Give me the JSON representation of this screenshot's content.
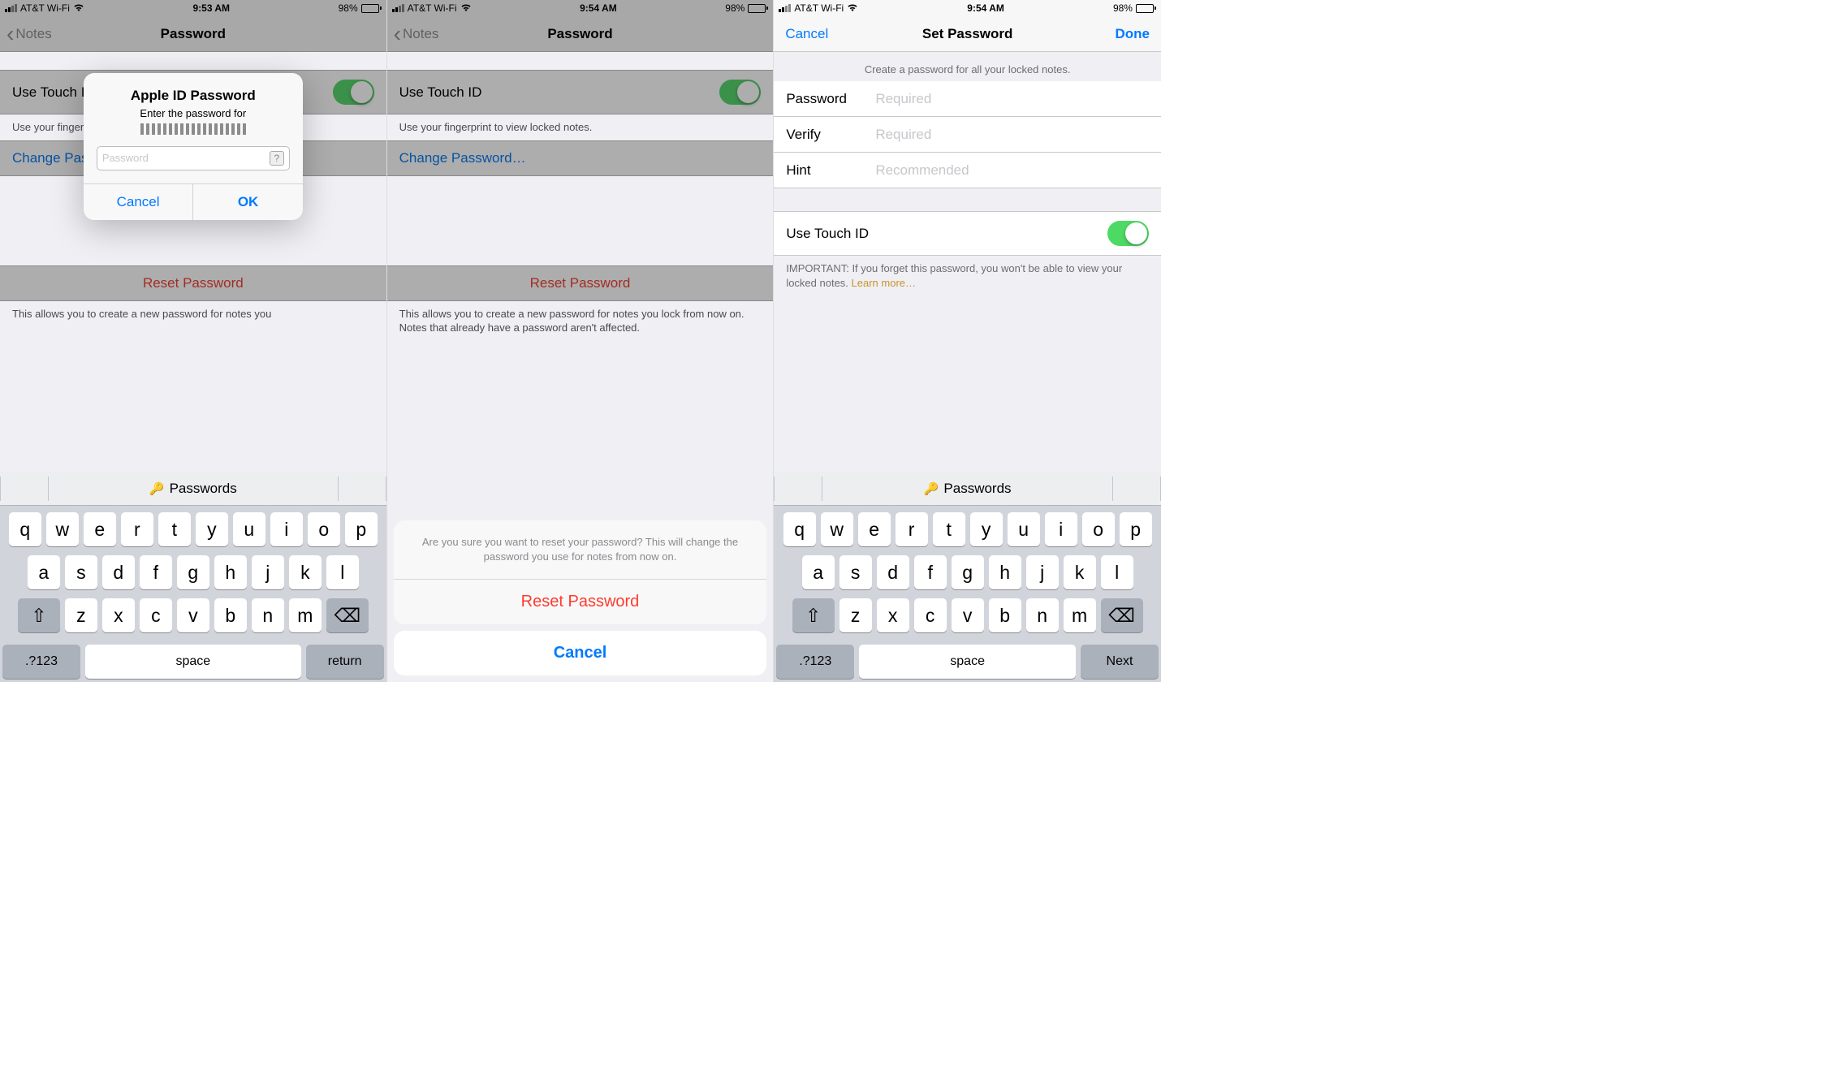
{
  "screens": [
    {
      "status": {
        "carrier": "AT&T Wi-Fi",
        "time": "9:53 AM",
        "battery_pct": "98%"
      },
      "nav": {
        "back": "Notes",
        "title": "Password"
      },
      "settings": {
        "use_touch_id_label": "Use Touch ID",
        "use_touch_id_on": true,
        "touch_id_footer": "Use your fingerprint to view locked notes.",
        "change_password_label": "Change Password…",
        "reset_password_label": "Reset Password",
        "reset_footer": "This allows you to create a new password for notes you"
      },
      "alert": {
        "title": "Apple ID Password",
        "message": "Enter the password for",
        "input_placeholder": "Password",
        "cancel": "Cancel",
        "ok": "OK"
      },
      "keyboard": {
        "suggestion": "Passwords",
        "row1": [
          "q",
          "w",
          "e",
          "r",
          "t",
          "y",
          "u",
          "i",
          "o",
          "p"
        ],
        "row2": [
          "a",
          "s",
          "d",
          "f",
          "g",
          "h",
          "j",
          "k",
          "l"
        ],
        "row3": [
          "z",
          "x",
          "c",
          "v",
          "b",
          "n",
          "m"
        ],
        "numkey": ".?123",
        "space": "space",
        "return": "return"
      }
    },
    {
      "status": {
        "carrier": "AT&T Wi-Fi",
        "time": "9:54 AM",
        "battery_pct": "98%"
      },
      "nav": {
        "back": "Notes",
        "title": "Password"
      },
      "settings": {
        "use_touch_id_label": "Use Touch ID",
        "use_touch_id_on": true,
        "touch_id_footer": "Use your fingerprint to view locked notes.",
        "change_password_label": "Change Password…",
        "reset_password_label": "Reset Password",
        "reset_footer": "This allows you to create a new password for notes you lock from now on. Notes that already have a password aren't affected."
      },
      "sheet": {
        "message": "Are you sure you want to reset your password? This will change the password you use for notes from now on.",
        "action": "Reset Password",
        "cancel": "Cancel"
      }
    },
    {
      "status": {
        "carrier": "AT&T Wi-Fi",
        "time": "9:54 AM",
        "battery_pct": "98%"
      },
      "nav": {
        "cancel": "Cancel",
        "title": "Set Password",
        "done": "Done"
      },
      "form": {
        "header": "Create a password for all your locked notes.",
        "password_label": "Password",
        "password_placeholder": "Required",
        "verify_label": "Verify",
        "verify_placeholder": "Required",
        "hint_label": "Hint",
        "hint_placeholder": "Recommended",
        "use_touch_id_label": "Use Touch ID",
        "use_touch_id_on": true,
        "important_prefix": "IMPORTANT: If you forget this password, you won't be able to view your locked notes. ",
        "learn_more": "Learn more…"
      },
      "keyboard": {
        "suggestion": "Passwords",
        "row1": [
          "q",
          "w",
          "e",
          "r",
          "t",
          "y",
          "u",
          "i",
          "o",
          "p"
        ],
        "row2": [
          "a",
          "s",
          "d",
          "f",
          "g",
          "h",
          "j",
          "k",
          "l"
        ],
        "row3": [
          "z",
          "x",
          "c",
          "v",
          "b",
          "n",
          "m"
        ],
        "numkey": ".?123",
        "space": "space",
        "return": "Next"
      }
    }
  ]
}
